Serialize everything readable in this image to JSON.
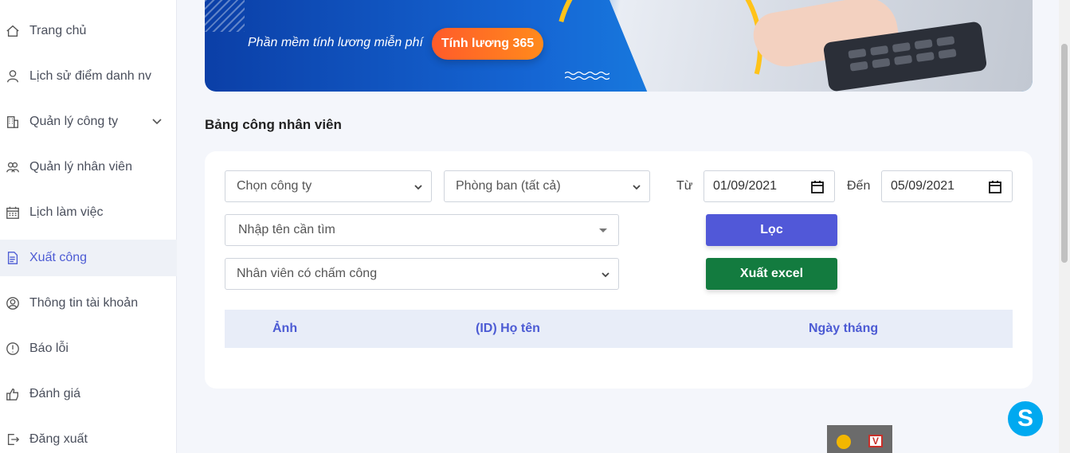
{
  "sidebar": {
    "items": [
      {
        "label": "Trang chủ",
        "icon": "home-icon"
      },
      {
        "label": "Lịch sử điểm danh nv",
        "icon": "user-clock-icon"
      },
      {
        "label": "Quản lý công ty",
        "icon": "building-icon"
      },
      {
        "label": "Quản lý nhân viên",
        "icon": "users-icon"
      },
      {
        "label": "Lịch làm việc",
        "icon": "calendar-icon"
      },
      {
        "label": "Xuất công",
        "icon": "document-icon"
      },
      {
        "label": "Thông tin tài khoản",
        "icon": "user-circle-icon"
      },
      {
        "label": "Báo lỗi",
        "icon": "alert-circle-icon"
      },
      {
        "label": "Đánh giá",
        "icon": "review-icon"
      },
      {
        "label": "Đăng xuất",
        "icon": "logout-icon"
      }
    ],
    "active": "Xuất công"
  },
  "banner": {
    "tagline": "Phần mềm tính lương miễn phí",
    "cta_label": "Tính lương 365"
  },
  "page": {
    "title": "Bảng công nhân viên"
  },
  "filters": {
    "company_select": "Chọn công ty",
    "department_select": "Phòng ban (tất cả)",
    "from_label": "Từ",
    "from_date": "01/09/2021",
    "to_label": "Đến",
    "to_date": "05/09/2021",
    "name_search": "Nhập tên cần tìm",
    "employee_filter": "Nhân viên có chấm công",
    "filter_button": "Lọc",
    "export_button": "Xuất excel"
  },
  "table": {
    "columns": [
      "Ảnh",
      "(ID) Họ tên",
      "Ngày tháng"
    ]
  },
  "colors": {
    "accent": "#5158d8",
    "export": "#137b3f",
    "cta": "#ff6a24"
  }
}
